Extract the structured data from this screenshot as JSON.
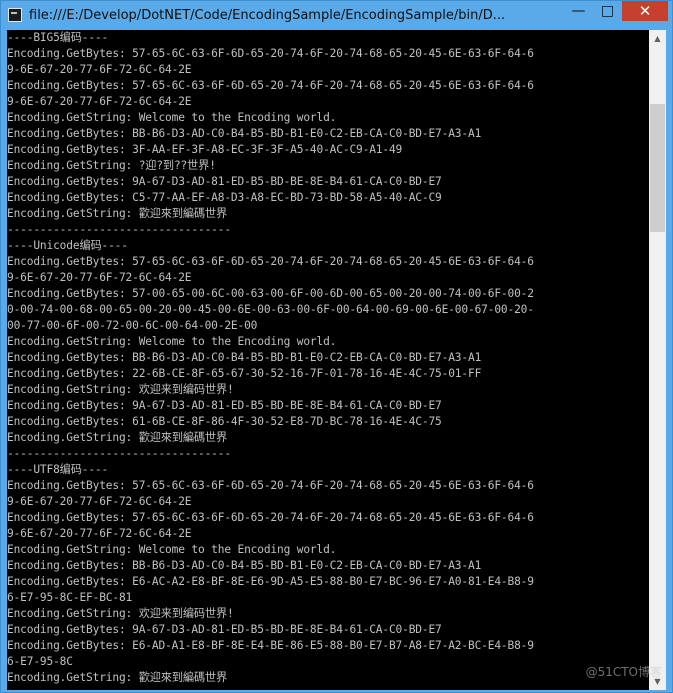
{
  "window": {
    "title": "file:///E:/Develop/DotNET/Code/EncodingSample/EncodingSample/bin/D...",
    "minimize_glyph": "—",
    "maximize_glyph": "□",
    "close_glyph": "✕"
  },
  "console": {
    "lines": [
      "----BIG5编码----",
      "Encoding.GetBytes: 57-65-6C-63-6F-6D-65-20-74-6F-20-74-68-65-20-45-6E-63-6F-64-6",
      "9-6E-67-20-77-6F-72-6C-64-2E",
      "Encoding.GetBytes: 57-65-6C-63-6F-6D-65-20-74-6F-20-74-68-65-20-45-6E-63-6F-64-6",
      "9-6E-67-20-77-6F-72-6C-64-2E",
      "Encoding.GetString: Welcome to the Encoding world.",
      "Encoding.GetBytes: BB-B6-D3-AD-C0-B4-B5-BD-B1-E0-C2-EB-CA-C0-BD-E7-A3-A1",
      "Encoding.GetBytes: 3F-AA-EF-3F-A8-EC-3F-3F-A5-40-AC-C9-A1-49",
      "Encoding.GetString: ?迎?到??世界!",
      "Encoding.GetBytes: 9A-67-D3-AD-81-ED-B5-BD-BE-8E-B4-61-CA-C0-BD-E7",
      "Encoding.GetBytes: C5-77-AA-EF-A8-D3-A8-EC-BD-73-BD-58-A5-40-AC-C9",
      "Encoding.GetString: 歡迎來到編碼世界",
      "----------------------------------",
      "----Unicode编码----",
      "Encoding.GetBytes: 57-65-6C-63-6F-6D-65-20-74-6F-20-74-68-65-20-45-6E-63-6F-64-6",
      "9-6E-67-20-77-6F-72-6C-64-2E",
      "Encoding.GetBytes: 57-00-65-00-6C-00-63-00-6F-00-6D-00-65-00-20-00-74-00-6F-00-2",
      "0-00-74-00-68-00-65-00-20-00-45-00-6E-00-63-00-6F-00-64-00-69-00-6E-00-67-00-20-",
      "00-77-00-6F-00-72-00-6C-00-64-00-2E-00",
      "Encoding.GetString: Welcome to the Encoding world.",
      "Encoding.GetBytes: BB-B6-D3-AD-C0-B4-B5-BD-B1-E0-C2-EB-CA-C0-BD-E7-A3-A1",
      "Encoding.GetBytes: 22-6B-CE-8F-65-67-30-52-16-7F-01-78-16-4E-4C-75-01-FF",
      "Encoding.GetString: 欢迎来到编码世界!",
      "Encoding.GetBytes: 9A-67-D3-AD-81-ED-B5-BD-BE-8E-B4-61-CA-C0-BD-E7",
      "Encoding.GetBytes: 61-6B-CE-8F-86-4F-30-52-E8-7D-BC-78-16-4E-4C-75",
      "Encoding.GetString: 歡迎來到編碼世界",
      "----------------------------------",
      "----UTF8编码----",
      "Encoding.GetBytes: 57-65-6C-63-6F-6D-65-20-74-6F-20-74-68-65-20-45-6E-63-6F-64-6",
      "9-6E-67-20-77-6F-72-6C-64-2E",
      "Encoding.GetBytes: 57-65-6C-63-6F-6D-65-20-74-6F-20-74-68-65-20-45-6E-63-6F-64-6",
      "9-6E-67-20-77-6F-72-6C-64-2E",
      "Encoding.GetString: Welcome to the Encoding world.",
      "Encoding.GetBytes: BB-B6-D3-AD-C0-B4-B5-BD-B1-E0-C2-EB-CA-C0-BD-E7-A3-A1",
      "Encoding.GetBytes: E6-AC-A2-E8-BF-8E-E6-9D-A5-E5-88-B0-E7-BC-96-E7-A0-81-E4-B8-9",
      "6-E7-95-8C-EF-BC-81",
      "Encoding.GetString: 欢迎来到编码世界!",
      "Encoding.GetBytes: 9A-67-D3-AD-81-ED-B5-BD-BE-8E-B4-61-CA-C0-BD-E7",
      "Encoding.GetBytes: E6-AD-A1-E8-BF-8E-E4-BE-86-E5-88-B0-E7-B7-A8-E7-A2-BC-E4-B8-9",
      "6-E7-95-8C",
      "Encoding.GetString: 歡迎來到編碼世界"
    ]
  },
  "watermark": "@51CTO博客"
}
